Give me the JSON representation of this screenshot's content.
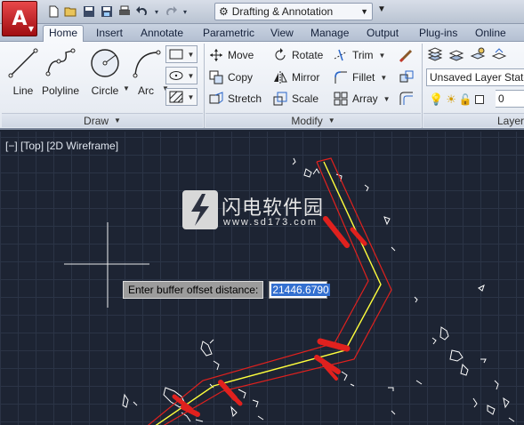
{
  "app": {
    "logo_letter": "A"
  },
  "quick_access": {
    "icons": [
      "new-icon",
      "open-icon",
      "save-icon",
      "save-as-icon",
      "plot-icon",
      "undo-icon",
      "redo-icon"
    ],
    "workspace": "Drafting & Annotation"
  },
  "tabs": [
    "Home",
    "Insert",
    "Annotate",
    "Parametric",
    "View",
    "Manage",
    "Output",
    "Plug-ins",
    "Online"
  ],
  "active_tab": "Home",
  "draw_panel": {
    "title": "Draw",
    "tools": [
      "Line",
      "Polyline",
      "Circle",
      "Arc"
    ]
  },
  "modify_panel": {
    "title": "Modify",
    "tools": {
      "move": "Move",
      "rotate": "Rotate",
      "trim": "Trim",
      "copy": "Copy",
      "mirror": "Mirror",
      "fillet": "Fillet",
      "stretch": "Stretch",
      "scale": "Scale",
      "array": "Array"
    }
  },
  "layers_panel": {
    "title": "Layer",
    "current_layer_state": "Unsaved Layer State",
    "current_layer": "0"
  },
  "viewport": {
    "label": "[−] [Top] [2D Wireframe]"
  },
  "watermark": {
    "text": "闪电软件园",
    "url": "www.sd173.com"
  },
  "command_prompt": {
    "label": "Enter buffer offset distance:",
    "value": "21446.6790"
  },
  "colors": {
    "canvas_bg": "#1d2433",
    "buffer_red": "#e0211e",
    "centerline_yellow": "#ffff3c",
    "feature_white": "#ffffff"
  }
}
